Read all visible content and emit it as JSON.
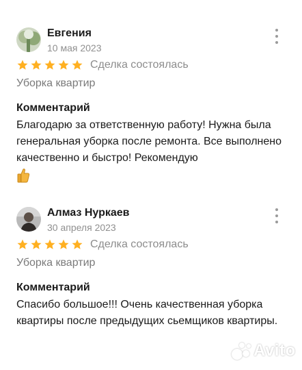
{
  "reviews": [
    {
      "author": "Евгения",
      "date": "10 мая 2023",
      "rating": 5,
      "deal_status": "Сделка состоялась",
      "service": "Уборка квартир",
      "comment_title": "Комментарий",
      "comment": "Благодарю за ответственную работу! Нужна была генеральная уборка после ремонта. Все выполнено качественно и быстро! Рекомендую",
      "has_thumb_emoji": true
    },
    {
      "author": "Алмаз Нуркаев",
      "date": "30 апреля 2023",
      "rating": 5,
      "deal_status": "Сделка состоялась",
      "service": "Уборка квартир",
      "comment_title": "Комментарий",
      "comment": "Спасибо большое!!! Очень качественная уборка квартиры после предыдущих сьемщиков квартиры.",
      "has_thumb_emoji": false
    }
  ],
  "watermark": "Avito",
  "colors": {
    "star": "#ffb021",
    "muted": "#8f8f8f",
    "text": "#1a1a1a"
  },
  "icons": {
    "star": "star-icon",
    "more": "more-vertical-icon",
    "thumb": "thumbs-up-icon"
  }
}
